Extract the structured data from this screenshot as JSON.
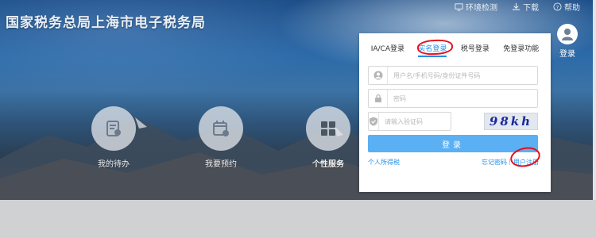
{
  "header": {
    "site_title": "国家税务总局上海市电子税务局",
    "links": [
      {
        "label": "环境检测",
        "icon": "monitor-check-icon"
      },
      {
        "label": "下载",
        "icon": "download-icon"
      },
      {
        "label": "帮助",
        "icon": "help-icon"
      }
    ],
    "user_label": "登录"
  },
  "services": [
    {
      "label": "我的待办",
      "icon": "todo-list-icon"
    },
    {
      "label": "我要预约",
      "icon": "calendar-icon"
    },
    {
      "label": "个性服务",
      "icon": "grid-icon"
    }
  ],
  "login": {
    "tabs": [
      {
        "label": "IA/CA登录",
        "active": false
      },
      {
        "label": "实名登录",
        "active": true
      },
      {
        "label": "税号登录",
        "active": false
      },
      {
        "label": "免登录功能",
        "active": false
      }
    ],
    "username_placeholder": "用户名/手机号码/身份证件号码",
    "password_placeholder": "密码",
    "captcha_placeholder": "请输入验证码",
    "captcha_text": "98kh",
    "submit_label": "登录",
    "links": {
      "personal_tax": "个人所得税",
      "forgot_password": "忘记密码",
      "separator": "|",
      "register": "用户注册"
    }
  },
  "colors": {
    "accent": "#1f8fe6",
    "button": "#5ab0f2",
    "annotation": "#e8101f"
  }
}
